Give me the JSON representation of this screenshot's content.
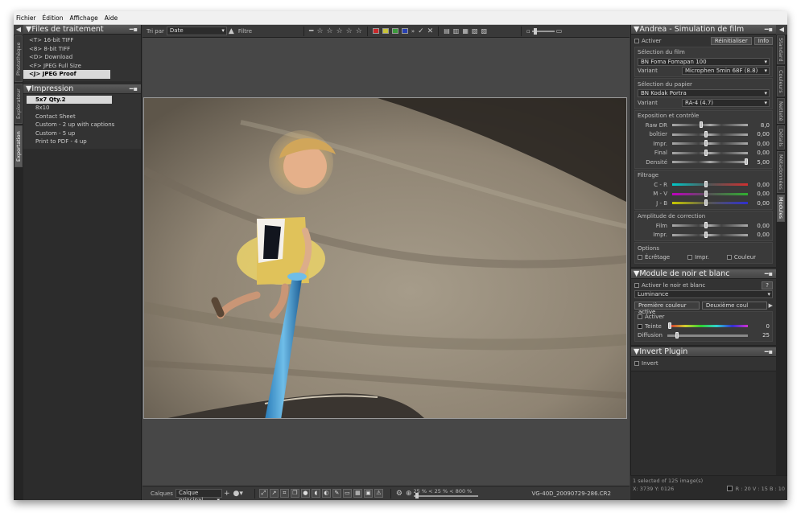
{
  "menu": [
    "Fichier",
    "Édition",
    "Affichage",
    "Aide"
  ],
  "left_tabs": [
    "Photothèque",
    "Explorateur",
    "Exportation"
  ],
  "right_tabs": [
    "Standard",
    "Couleurs",
    "Netteté",
    "Détails",
    "Métadonnées",
    "Modules"
  ],
  "files_panel": {
    "title": "Files de traitement",
    "items": [
      "<T> 16-bit TIFF",
      "<8> 8-bit TIFF",
      "<D> Download",
      "<F> JPEG Full Size",
      "<J> JPEG Proof"
    ]
  },
  "print_panel": {
    "title": "Impression",
    "items": [
      "5x7 Qty.2",
      "8x10",
      "Contact Sheet",
      "Custom - 2 up with captions",
      "Custom - 5 up",
      "Print to PDF - 4 up"
    ]
  },
  "top_toolbar": {
    "sort_label": "Tri par",
    "sort_value": "Date",
    "filter_label": "Filtre"
  },
  "colors": {
    "red": "#c8282a",
    "yellow": "#c8c43a",
    "green": "#3c9a3c",
    "blue": "#2840b0"
  },
  "film_panel": {
    "title": "Andrea - Simulation de film",
    "activate": "Activer",
    "reset": "Réinitialiser",
    "info": "Info",
    "film_section": "Sélection du film",
    "film_value": "BN Foma Fomapan 100",
    "variant_label": "Variant",
    "film_variant": "Microphen  5min 68F (8.8)",
    "paper_section": "Sélection du papier",
    "paper_value": "BN Kodak Portra",
    "paper_variant": "RA-4 (4.7)",
    "exposure_section": "Exposition et contrôle",
    "exposure": [
      {
        "label": "Raw DR",
        "value": "8,0",
        "pos": 0.38
      },
      {
        "label": "boîtier",
        "value": "0,00",
        "pos": 0.45
      },
      {
        "label": "Impr.",
        "value": "0,00",
        "pos": 0.45
      },
      {
        "label": "Final",
        "value": "0,00",
        "pos": 0.45
      },
      {
        "label": "Densité",
        "value": "5,00",
        "pos": 0.98
      }
    ],
    "filter_section": "Filtrage",
    "filters": [
      {
        "label": "C - R",
        "value": "0,00",
        "pos": 0.45,
        "c1": "#00c8c8",
        "c2": "#d03030"
      },
      {
        "label": "M - V",
        "value": "0,00",
        "pos": 0.45,
        "c1": "#c000c0",
        "c2": "#30b030"
      },
      {
        "label": "J - B",
        "value": "0,00",
        "pos": 0.45,
        "c1": "#c8c800",
        "c2": "#3030d0"
      }
    ],
    "amp_section": "Amplitude de correction",
    "amp": [
      {
        "label": "Film",
        "value": "0,00",
        "pos": 0.45
      },
      {
        "label": "Impr.",
        "value": "0,00",
        "pos": 0.45
      }
    ],
    "options_section": "Options",
    "opt1": "Écrêtage",
    "opt2": "Impr.",
    "opt3": "Couleur"
  },
  "bw_panel": {
    "title": "Module de noir et blanc",
    "activate": "Activer le noir et blanc",
    "help": "?",
    "mode": "Luminance",
    "first_color": "Première couleur active",
    "second_color": "Deuxième coul",
    "sub_activate": "Activer",
    "tint_label": "Teinte",
    "tint_value": "0",
    "tint_pos": 0.0,
    "diff_label": "Diffusion",
    "diff_value": "25",
    "diff_pos": 0.12
  },
  "invert_panel": {
    "title": "Invert Plugin",
    "activate": "Invert"
  },
  "bottom_toolbar": {
    "layers_label": "Calques",
    "layers_value": "Calque principal",
    "zoom": "25 % < 25 % < 800 %",
    "filename": "VG-40D_20090729-286.CR2"
  },
  "status": {
    "selection": "1 selected of 125 image(s)",
    "coords": "X: 3739  Y: 0126",
    "rgb": "R : 20   V : 15   B : 10"
  }
}
